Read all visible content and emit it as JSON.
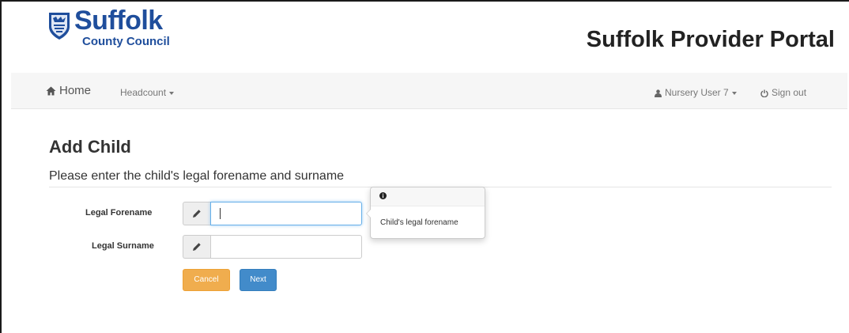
{
  "header": {
    "brand_name": "Suffolk",
    "brand_sub": "County Council",
    "portal_title": "Suffolk Provider Portal"
  },
  "nav": {
    "home_label": "Home",
    "home_icon": "home-icon",
    "headcount_label": "Headcount",
    "user_label": "Nursery User 7",
    "user_icon": "user-icon",
    "signout_label": "Sign out",
    "signout_icon": "power-icon"
  },
  "main": {
    "page_title": "Add Child",
    "subtitle": "Please enter the child's legal forename and surname",
    "forename": {
      "label": "Legal Forename",
      "value": "",
      "icon": "pencil-icon"
    },
    "surname": {
      "label": "Legal Surname",
      "value": "",
      "icon": "pencil-icon"
    },
    "popover": {
      "icon": "info-icon",
      "text": "Child's legal forename"
    },
    "cancel_label": "Cancel",
    "next_label": "Next"
  },
  "colors": {
    "brand_blue": "#1f4e9c",
    "cancel_orange": "#f0ad4e",
    "next_blue": "#428bca"
  }
}
